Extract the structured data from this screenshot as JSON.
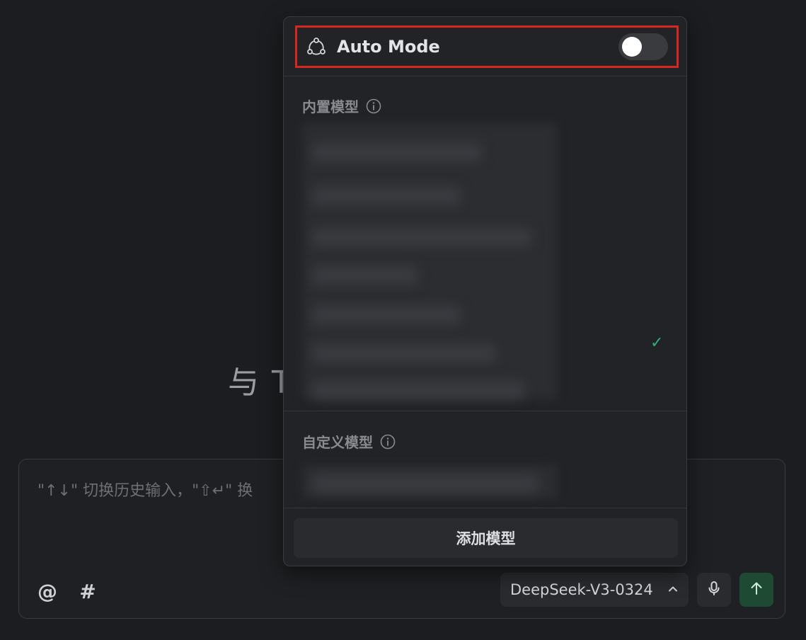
{
  "background": {
    "welcome_text": "与 T"
  },
  "chat": {
    "placeholder": "\"↑↓\" 切换历史输入，\"⇧↵\" 换",
    "at_label": "@",
    "hash_label": "#",
    "model_select": {
      "value": "DeepSeek-V3-0324",
      "chevron": "chevron-up-icon"
    },
    "mic_icon": "mic-icon",
    "send_icon": "arrow-up-icon"
  },
  "popup": {
    "auto_mode": {
      "label": "Auto Mode",
      "enabled": false,
      "icon": "auto-mode-icon"
    },
    "builtin_section": {
      "title": "内置模型",
      "info_icon": "info-icon",
      "selected_check": "✓"
    },
    "custom_section": {
      "title": "自定义模型",
      "info_icon": "info-icon"
    },
    "add_model_label": "添加模型"
  },
  "colors": {
    "background": "#1c1d20",
    "popup_bg": "#222326",
    "highlight_border": "#d4271f",
    "check_green": "#2fb07a",
    "send_bg": "#1e4a33"
  }
}
